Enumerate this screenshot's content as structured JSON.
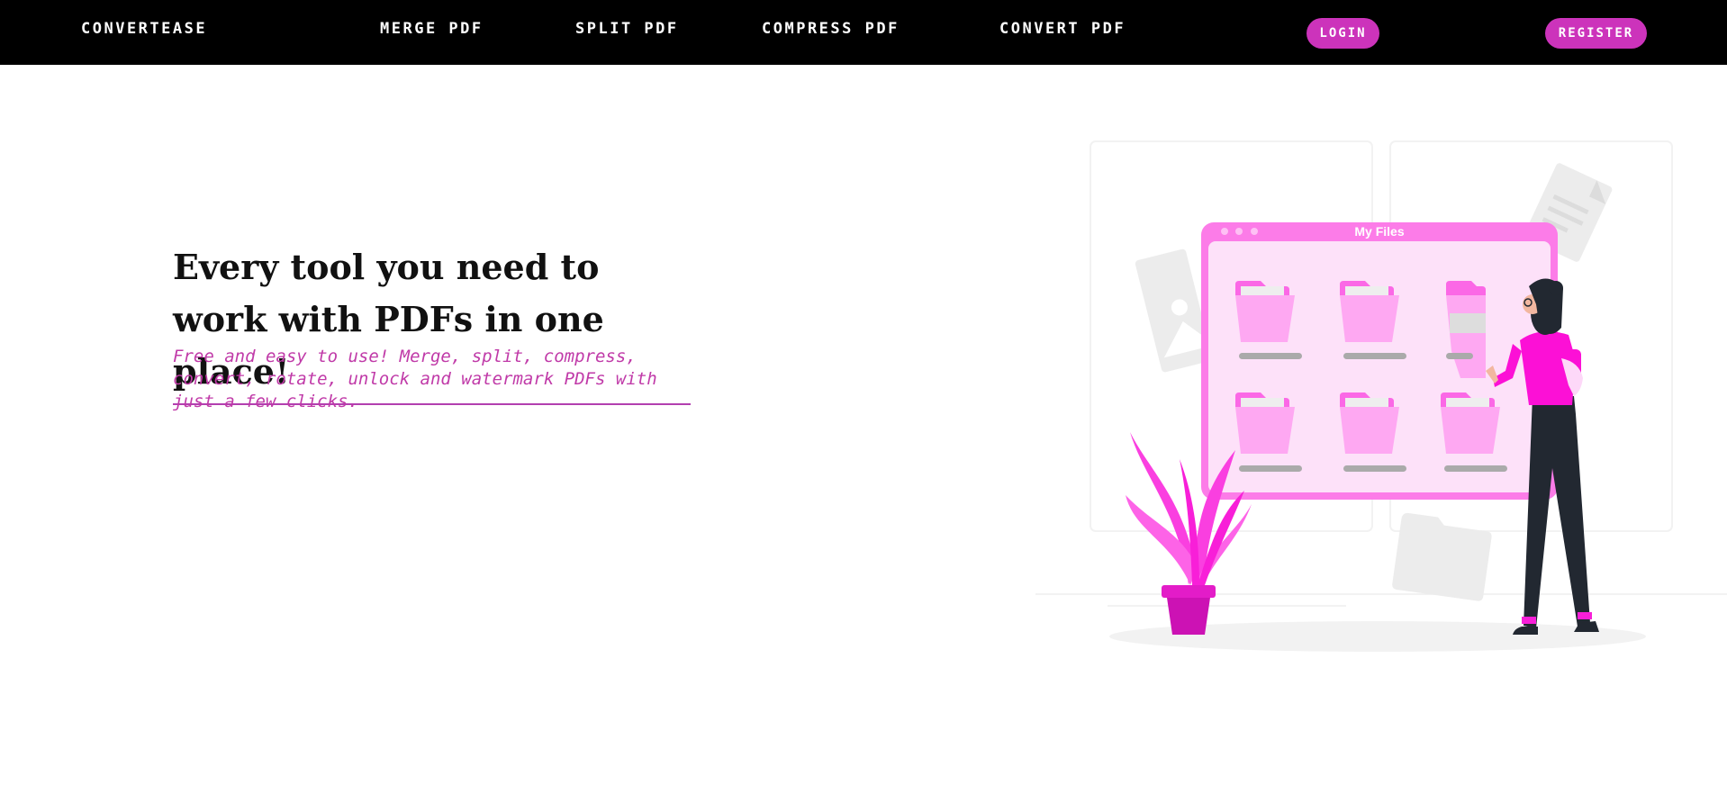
{
  "navbar": {
    "brand": "CONVERTEASE",
    "links": [
      "MERGE PDF",
      "SPLIT PDF",
      "COMPRESS PDF",
      "CONVERT PDF"
    ],
    "login_label": "LOGIN",
    "register_label": "REGISTER"
  },
  "hero": {
    "title": "Every tool you need to work with PDFs in one place!",
    "subtitle": "Free and easy to use! Merge, split, compress, convert, rotate, unlock and watermark PDFs with just a few clicks."
  },
  "illustration": {
    "window_title": "My Files"
  },
  "colors": {
    "nav_bg": "#000000",
    "accent": "#cc33bb",
    "subtitle": "#c03aa8",
    "magenta": "#ff21d8"
  }
}
